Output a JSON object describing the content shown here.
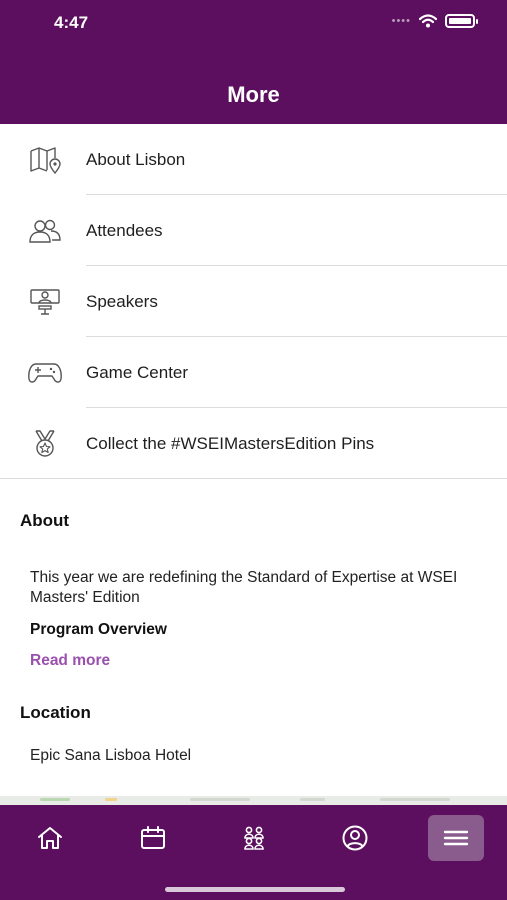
{
  "status_bar": {
    "time": "4:47"
  },
  "header": {
    "title": "More"
  },
  "menu": {
    "items": [
      {
        "label": "About Lisbon",
        "icon": "map-pin-icon"
      },
      {
        "label": "Attendees",
        "icon": "people-icon"
      },
      {
        "label": "Speakers",
        "icon": "presenter-icon"
      },
      {
        "label": "Game Center",
        "icon": "gamepad-icon"
      },
      {
        "label": "Collect the #WSEIMastersEdition Pins",
        "icon": "medal-icon"
      }
    ]
  },
  "about": {
    "heading": "About",
    "text": "This year we are redefining the Standard of Expertise at WSEI Masters' Edition",
    "program_title": "Program Overview",
    "read_more": "Read more"
  },
  "location": {
    "heading": "Location",
    "text": "Epic Sana Lisboa Hotel"
  },
  "tab_bar": {
    "tabs": [
      {
        "icon": "home-icon",
        "active": false
      },
      {
        "icon": "calendar-icon",
        "active": false
      },
      {
        "icon": "group-icon",
        "active": false
      },
      {
        "icon": "profile-icon",
        "active": false
      },
      {
        "icon": "menu-icon",
        "active": true
      }
    ]
  },
  "colors": {
    "brand": "#5b0f5e",
    "accent": "#9b4fae",
    "active_tab": "#8a5b8d"
  }
}
